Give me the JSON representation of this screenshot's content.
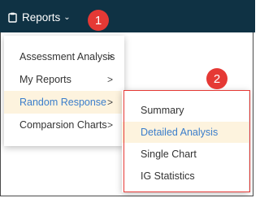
{
  "topbar": {
    "reports_label": "Reports",
    "reports_icon": "clipboard-icon",
    "dropdown_icon": "chevron-down-icon",
    "background": "#0f3244"
  },
  "annotations": {
    "badge1": "1",
    "badge2": "2",
    "color": "#e53935"
  },
  "menu": {
    "items": [
      {
        "label": "Assessment Analysis",
        "has_submenu": true,
        "active": false
      },
      {
        "label": "My Reports",
        "has_submenu": true,
        "active": false
      },
      {
        "label": "Random Response",
        "has_submenu": true,
        "active": true
      },
      {
        "label": "Comparsion Charts",
        "has_submenu": true,
        "active": false
      }
    ],
    "arrow_glyph": ">"
  },
  "submenu": {
    "items": [
      {
        "label": "Summary",
        "active": false
      },
      {
        "label": "Detailed Analysis",
        "active": true
      },
      {
        "label": "Single Chart",
        "active": false
      },
      {
        "label": "IG Statistics",
        "active": false
      }
    ]
  },
  "colors": {
    "active_bg": "#fdf3de",
    "active_text": "#3b7ecb"
  }
}
